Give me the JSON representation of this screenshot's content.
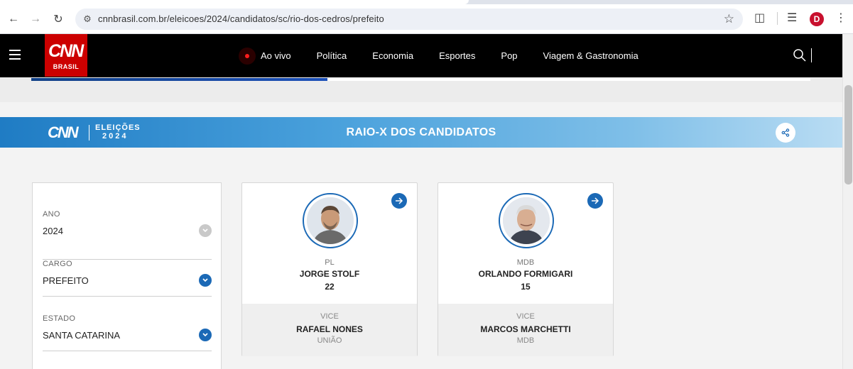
{
  "browser": {
    "url": "cnnbrasil.com.br/eleicoes/2024/candidatos/sc/rio-dos-cedros/prefeito",
    "profile_initial": "D"
  },
  "site": {
    "logo_text": "CNN",
    "logo_sub": "BRASIL",
    "brand_color": "#cc0000",
    "menu": [
      {
        "label": "Ao vivo"
      },
      {
        "label": "Política"
      },
      {
        "label": "Economia"
      },
      {
        "label": "Esportes"
      },
      {
        "label": "Pop"
      },
      {
        "label": "Viagem & Gastronomia"
      }
    ]
  },
  "banner": {
    "logo_text": "CNN",
    "election_line1": "ELEIÇÕES",
    "election_line2": "2024",
    "title": "RAIO-X DOS CANDIDATOS"
  },
  "filters": {
    "ano": {
      "label": "ANO",
      "value": "2024"
    },
    "cargo": {
      "label": "CARGO",
      "value": "PREFEITO"
    },
    "estado": {
      "label": "ESTADO",
      "value": "SANTA CATARINA"
    }
  },
  "candidates": [
    {
      "party": "PL",
      "name": "JORGE STOLF",
      "number": "22",
      "vice_label": "VICE",
      "vice_name": "RAFAEL NONES",
      "vice_party": "UNIÃO"
    },
    {
      "party": "MDB",
      "name": "ORLANDO FORMIGARI",
      "number": "15",
      "vice_label": "VICE",
      "vice_name": "MARCOS MARCHETTI",
      "vice_party": "MDB"
    }
  ],
  "colors": {
    "accent": "#1b69b6",
    "nav_bg": "#000000"
  }
}
